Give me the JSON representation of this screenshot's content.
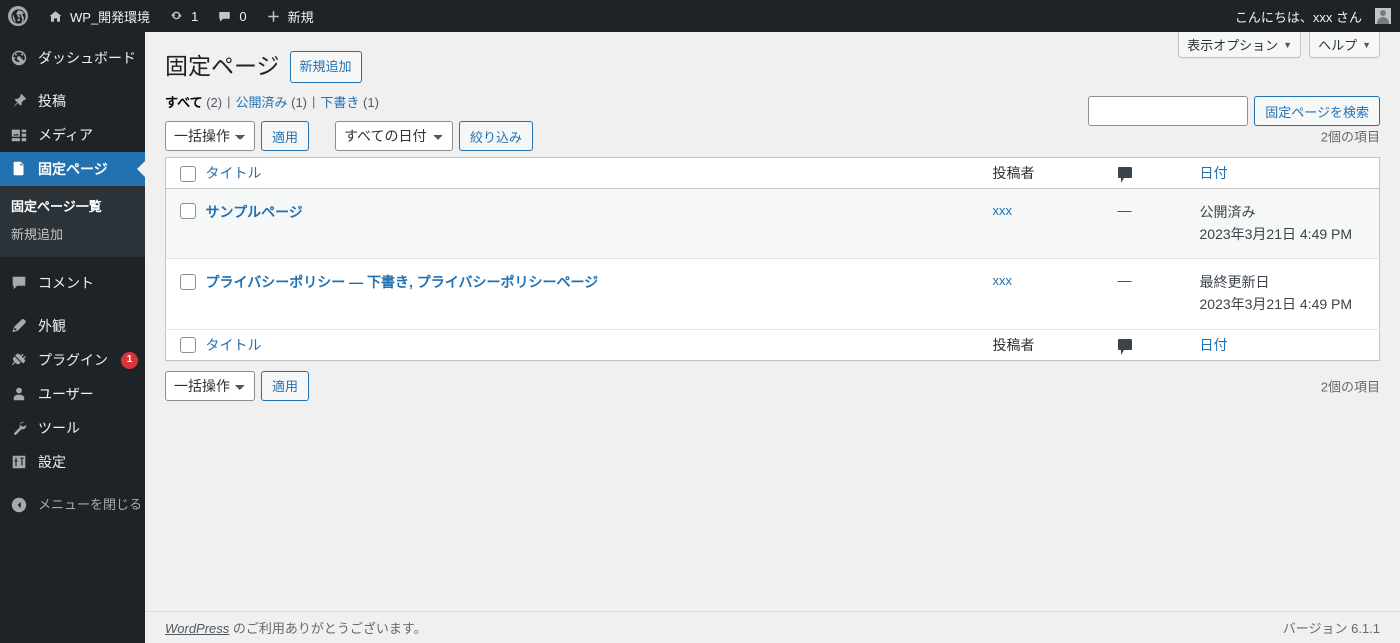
{
  "adminbar": {
    "logo_icon": "wordpress-logo-icon",
    "site_name": "WP_開発環境",
    "updates_icon": "updates-icon",
    "updates_count": "1",
    "comments_icon": "comments-icon",
    "comments_count": "0",
    "new_icon": "plus-icon",
    "new_label": "新規",
    "greeting": "こんにちは、xxx さん"
  },
  "sidebar": {
    "items": [
      {
        "label": "ダッシュボード",
        "icon": "dashboard-icon",
        "name": "dashboard"
      },
      {
        "label": "投稿",
        "icon": "pin-icon",
        "name": "posts"
      },
      {
        "label": "メディア",
        "icon": "media-icon",
        "name": "media"
      },
      {
        "label": "固定ページ",
        "icon": "pages-icon",
        "name": "pages",
        "current": true
      },
      {
        "label": "コメント",
        "icon": "comment-icon",
        "name": "comments"
      },
      {
        "label": "外観",
        "icon": "appearance-icon",
        "name": "appearance"
      },
      {
        "label": "プラグイン",
        "icon": "plugins-icon",
        "name": "plugins",
        "badge": "1"
      },
      {
        "label": "ユーザー",
        "icon": "users-icon",
        "name": "users"
      },
      {
        "label": "ツール",
        "icon": "tools-icon",
        "name": "tools"
      },
      {
        "label": "設定",
        "icon": "settings-icon",
        "name": "settings"
      }
    ],
    "submenu": [
      {
        "label": "固定ページ一覧",
        "current": true
      },
      {
        "label": "新規追加",
        "current": false
      }
    ],
    "collapse": {
      "label": "メニューを閉じる",
      "icon": "collapse-arrow-icon"
    }
  },
  "screen_meta": {
    "screen_options": "表示オプション",
    "help": "ヘルプ",
    "caret": "▼"
  },
  "header": {
    "title": "固定ページ",
    "add_new": "新規追加"
  },
  "filters": {
    "all": {
      "label": "すべて",
      "count": "(2)"
    },
    "published": {
      "label": "公開済み",
      "count": "(1)"
    },
    "draft": {
      "label": "下書き",
      "count": "(1)"
    },
    "separator": "|"
  },
  "search": {
    "value": "",
    "placeholder": "",
    "button": "固定ページを検索"
  },
  "tablenav_top": {
    "bulk_action_selected": "一括操作",
    "apply": "適用",
    "date_filter_selected": "すべての日付",
    "filter": "絞り込み",
    "displaying_num": "2個の項目"
  },
  "tablenav_bottom": {
    "bulk_action_selected": "一括操作",
    "apply": "適用",
    "displaying_num": "2個の項目"
  },
  "table": {
    "columns": {
      "title": "タイトル",
      "author": "投稿者",
      "comments_icon": "comment-bubble-icon",
      "date": "日付"
    },
    "rows": [
      {
        "title": "サンプルページ",
        "state": "",
        "author": "xxx",
        "comments": "—",
        "date_status": "公開済み",
        "date_value": "2023年3月21日 4:49 PM"
      },
      {
        "title": "プライバシーポリシー",
        "state": " — 下書き, プライバシーポリシーページ",
        "author": "xxx",
        "comments": "—",
        "date_status": "最終更新日",
        "date_value": "2023年3月21日 4:49 PM"
      }
    ]
  },
  "footer": {
    "thanks_link": "WordPress",
    "thanks_text": " のご利用ありがとうございます。",
    "version": "バージョン 6.1.1"
  }
}
